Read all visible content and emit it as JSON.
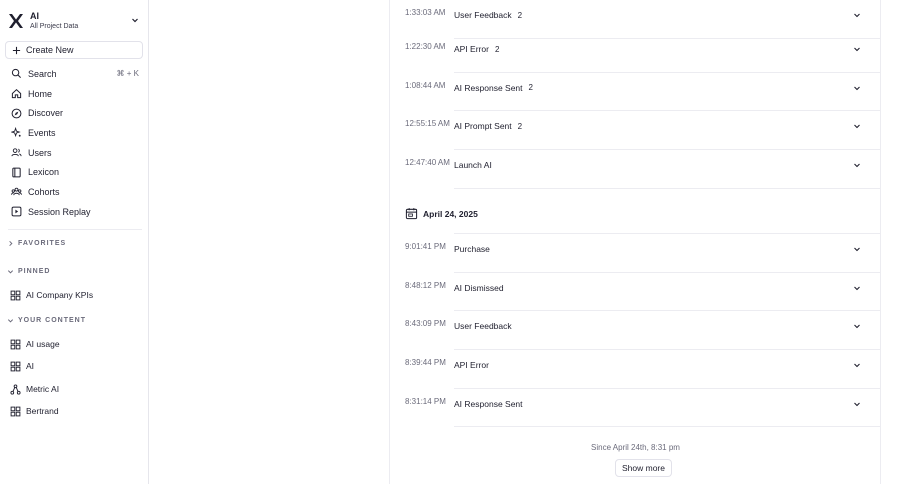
{
  "project": {
    "name": "AI",
    "subtitle": "All Project Data"
  },
  "create_new": "Create New",
  "nav": [
    {
      "label": "Search",
      "icon": "search-icon",
      "shortcut": "⌘ + K"
    },
    {
      "label": "Home",
      "icon": "home-icon"
    },
    {
      "label": "Discover",
      "icon": "compass-icon"
    },
    {
      "label": "Events",
      "icon": "sparkle-icon"
    },
    {
      "label": "Users",
      "icon": "users-icon"
    },
    {
      "label": "Lexicon",
      "icon": "book-icon"
    },
    {
      "label": "Cohorts",
      "icon": "cohorts-icon"
    },
    {
      "label": "Session Replay",
      "icon": "replay-icon"
    }
  ],
  "sections": {
    "favorites": "FAVORITES",
    "pinned": "PINNED",
    "your_content": "YOUR CONTENT"
  },
  "pinned_items": [
    {
      "label": "AI Company KPIs",
      "icon": "board-icon"
    }
  ],
  "content_items": [
    {
      "label": "AI usage",
      "icon": "board-icon"
    },
    {
      "label": "AI",
      "icon": "board-icon"
    },
    {
      "label": "Metric AI",
      "icon": "metric-tree-icon"
    },
    {
      "label": "Bertrand",
      "icon": "board-icon"
    }
  ],
  "events_top": [
    {
      "time": "1:33:03 AM",
      "name": "User Feedback",
      "count": "2"
    },
    {
      "time": "1:22:30 AM",
      "name": "API Error",
      "count": "2"
    },
    {
      "time": "1:08:44 AM",
      "name": "AI Response Sent",
      "count": "2"
    },
    {
      "time": "12:55:15 AM",
      "name": "AI Prompt Sent",
      "count": "2"
    },
    {
      "time": "12:47:40 AM",
      "name": "Launch AI",
      "count": ""
    }
  ],
  "date_header": "April 24, 2025",
  "events_bottom": [
    {
      "time": "9:01:41 PM",
      "name": "Purchase"
    },
    {
      "time": "8:48:12 PM",
      "name": "AI Dismissed"
    },
    {
      "time": "8:43:09 PM",
      "name": "User Feedback"
    },
    {
      "time": "8:39:44 PM",
      "name": "API Error"
    },
    {
      "time": "8:31:14 PM",
      "name": "AI Response Sent"
    }
  ],
  "since_text": "Since April 24th, 8:31 pm",
  "show_more": "Show more",
  "colors": {
    "text": "#1f1f2e",
    "muted": "#6b6b7b",
    "border": "#ececf1"
  }
}
